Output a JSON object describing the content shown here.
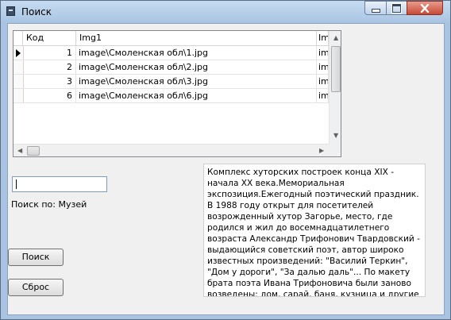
{
  "window": {
    "title": "Поиск"
  },
  "grid": {
    "columns": [
      "Код",
      "Img1",
      "Im"
    ],
    "rows": [
      {
        "code": "1",
        "img1": "image\\Смоленская обл\\1.jpg",
        "img2": "ima"
      },
      {
        "code": "2",
        "img1": "image\\Смоленская обл\\2.jpg",
        "img2": "ima"
      },
      {
        "code": "3",
        "img1": "image\\Смоленская обл\\3.jpg",
        "img2": "ima"
      },
      {
        "code": "6",
        "img1": "image\\Смоленская обл\\6.jpg",
        "img2": "ima"
      }
    ],
    "current_row": 0
  },
  "search": {
    "value": "",
    "search_by_label": "Поиск по: Музей"
  },
  "buttons": {
    "search": "Поиск",
    "reset": "Сброс"
  },
  "description": "Комплекс хуторских построек конца XIX - начала XX века.Мемориальная экспозиция.Ежегодный поэтический праздник.\nВ 1988 году открыт для посетителей возрожденный хутор Загорье, место, где родился и жил до восемнадцатилетнего возраста Александр Трифонович Твардовский - выдающийся советский поэт, автор широко известных произведений: \"Василий Теркин\", \"Дом у дороги\", \"За далью даль\"... По макету брата поэта Ивана Трифоновича были заново возведены: дом, сарай, баня, кузница и другие надворные постройки, разбит сад и",
  "icons": {
    "app": "app-window-icon",
    "minimize": "minimize-icon",
    "maximize": "maximize-icon",
    "close": "close-icon"
  }
}
